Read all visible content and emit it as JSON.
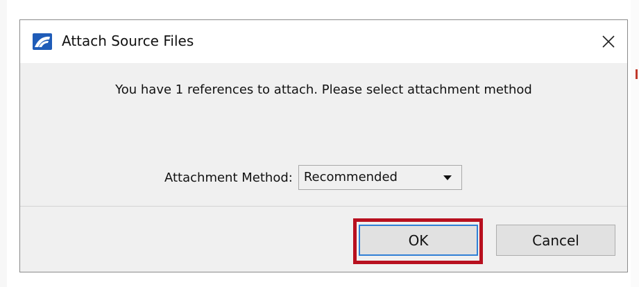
{
  "dialog": {
    "title": "Attach Source Files",
    "message": "You have 1 references to attach. Please select attachment method",
    "attachment_method_label": "Attachment Method:",
    "attachment_method_value": "Recommended",
    "ok_label": "OK",
    "cancel_label": "Cancel"
  },
  "icons": {
    "app": "bentley-app-icon",
    "close": "close-icon",
    "dropdown": "chevron-down-icon"
  },
  "colors": {
    "highlight": "#b8101f",
    "focus_border": "#2f7fd6",
    "app_icon": "#1f5cb8"
  }
}
